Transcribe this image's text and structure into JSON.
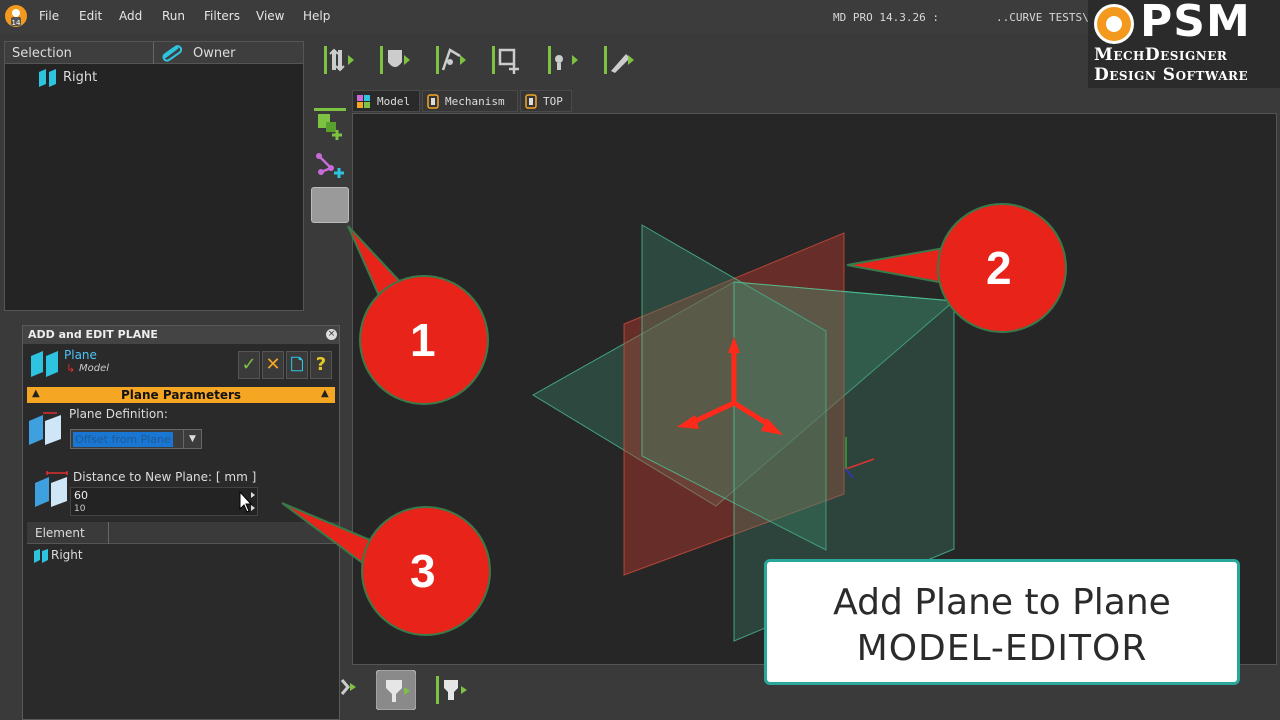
{
  "app": {
    "version": "MD PRO 14.3.26 :",
    "document_title": "..CURVE TESTS\\"
  },
  "menu": [
    "File",
    "Edit",
    "Add",
    "Run",
    "Filters",
    "View",
    "Help"
  ],
  "brand": {
    "name": "PSM",
    "line1": "MechDesigner",
    "line2": "Design Software",
    "accent_color": "#f39a1e"
  },
  "tree_panel": {
    "col_selection": "Selection",
    "col_owner": "Owner",
    "items": [
      {
        "label": "Right",
        "icon": "plane-icon"
      }
    ]
  },
  "dialog": {
    "title": "ADD and EDIT PLANE",
    "object_name": "Plane",
    "object_parent": "Model",
    "section_label": "Plane Parameters",
    "section_color": "#f5a623",
    "plane_definition_label": "Plane Definition:",
    "plane_definition_value": "Offset from Plane",
    "distance_label": "Distance to New Plane:    [ mm ]",
    "distance_value": "60",
    "distance_step": "10",
    "table_header": "Element",
    "table_rows": [
      {
        "label": "Right",
        "icon": "plane-icon"
      }
    ]
  },
  "viewport": {
    "tabs": [
      {
        "label": "Model",
        "active": true
      },
      {
        "label": "Mechanism",
        "active": false
      },
      {
        "label": "TOP",
        "active": false
      }
    ]
  },
  "callouts": [
    "1",
    "2",
    "3"
  ],
  "callout_color": "#e8231a",
  "caption": {
    "line1": "Add Plane to Plane",
    "line2": "MODEL-EDITOR",
    "border_color": "#2aa79b"
  }
}
